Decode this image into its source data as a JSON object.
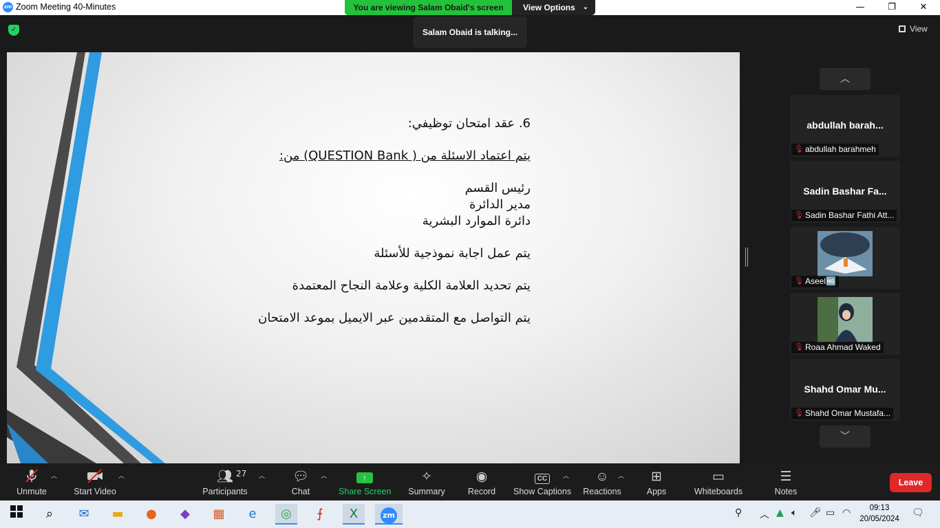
{
  "window": {
    "title": "Zoom Meeting 40-Minutes",
    "app_icon": "zm",
    "minimize": "—",
    "restore": "❐",
    "close": "✕"
  },
  "share_banner": {
    "status": "You are viewing Salam Obaid's screen",
    "options": "View Options",
    "status_color": "#22c33a"
  },
  "talking": "Salam Obaid is talking...",
  "view_button": "View",
  "slide": {
    "heading": "6. عقد امتحان توظيفي:",
    "subheading": "يتم اعتماد الاسئلة من ( QUESTION Bank) من:",
    "list": [
      "رئيس القسم",
      "مدير الدائرة",
      "دائرة الموارد البشرية"
    ],
    "line1": "يتم عمل اجابة نموذجية للأسئلة",
    "line2": "يتم تحديد العلامة الكلية وعلامة النجاح المعتمدة",
    "line3": "يتم التواصل مع المتقدمين عبر الايميل بموعد الامتحان"
  },
  "participants": [
    {
      "big_name": "abdullah  barah...",
      "label": "abdullah barahmeh",
      "has_photo": false
    },
    {
      "big_name": "Sadin Bashar Fa...",
      "label": "Sadin Bashar Fathi Att...",
      "has_photo": false
    },
    {
      "big_name": "",
      "label": "Aseel🆖",
      "has_photo": true
    },
    {
      "big_name": "",
      "label": "Roaa Ahmad Waked",
      "has_photo": true
    },
    {
      "big_name": "Shahd  Omar  Mu...",
      "label": "Shahd Omar Mustafa...",
      "has_photo": false
    }
  ],
  "toolbar": {
    "unmute": "Unmute",
    "start_video": "Start Video",
    "participants": "Participants",
    "participant_count": "27",
    "chat": "Chat",
    "share_screen": "Share Screen",
    "summary": "Summary",
    "record": "Record",
    "show_captions": "Show Captions",
    "captions_icon": "CC",
    "reactions": "Reactions",
    "apps": "Apps",
    "whiteboards": "Whiteboards",
    "notes": "Notes",
    "leave": "Leave",
    "leave_color": "#e02828"
  },
  "taskbar": {
    "time": "09:13",
    "date": "20/05/2024",
    "zoom_label": "zm"
  }
}
